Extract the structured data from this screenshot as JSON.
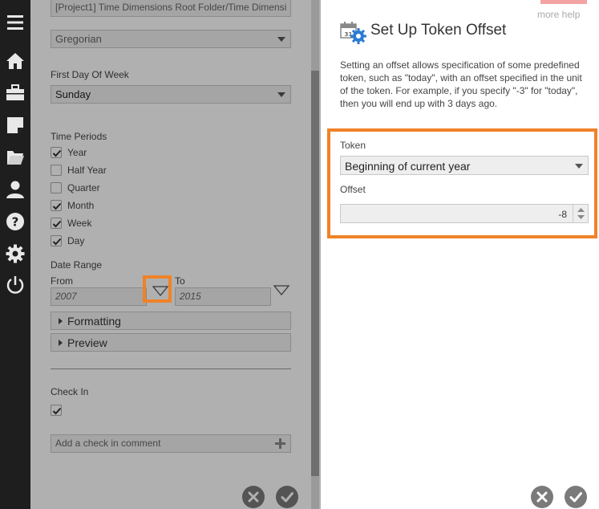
{
  "left_panel": {
    "folder_path_value": "[Project1] Time Dimensions Root Folder/Time Dimensi",
    "calendar_value": "Gregorian",
    "first_day_label": "First Day Of Week",
    "first_day_value": "Sunday",
    "time_periods_label": "Time Periods",
    "time_periods": [
      {
        "label": "Year",
        "checked": true
      },
      {
        "label": "Half Year",
        "checked": false
      },
      {
        "label": "Quarter",
        "checked": false
      },
      {
        "label": "Month",
        "checked": true
      },
      {
        "label": "Week",
        "checked": true
      },
      {
        "label": "Day",
        "checked": true
      }
    ],
    "date_range_label": "Date Range",
    "from_label": "From",
    "from_value": "2007",
    "to_label": "To",
    "to_value": "2015",
    "formatting_label": "Formatting",
    "preview_label": "Preview",
    "check_in_label": "Check In",
    "check_in_checked": true,
    "comment_placeholder": "Add a check in comment"
  },
  "right_panel": {
    "more_help": "more help",
    "title": "Set Up Token Offset",
    "description": "Setting an offset allows specification of some predefined token, such as \"today\", with an offset specified in the unit of the token. For example, if you specify \"-3\" for \"today\", then you will end up with 3 days ago.",
    "token_label": "Token",
    "token_value": "Beginning of current year",
    "offset_label": "Offset",
    "offset_value": "-8"
  },
  "rail_icons": [
    "menu-icon",
    "home-icon",
    "briefcase-icon",
    "note-icon",
    "folder-icon",
    "user-icon",
    "help-icon",
    "gear-icon",
    "power-icon"
  ],
  "colors": {
    "highlight": "#f08228",
    "rail": "#1e1e1e",
    "accent_blue": "#2b7cd3"
  }
}
